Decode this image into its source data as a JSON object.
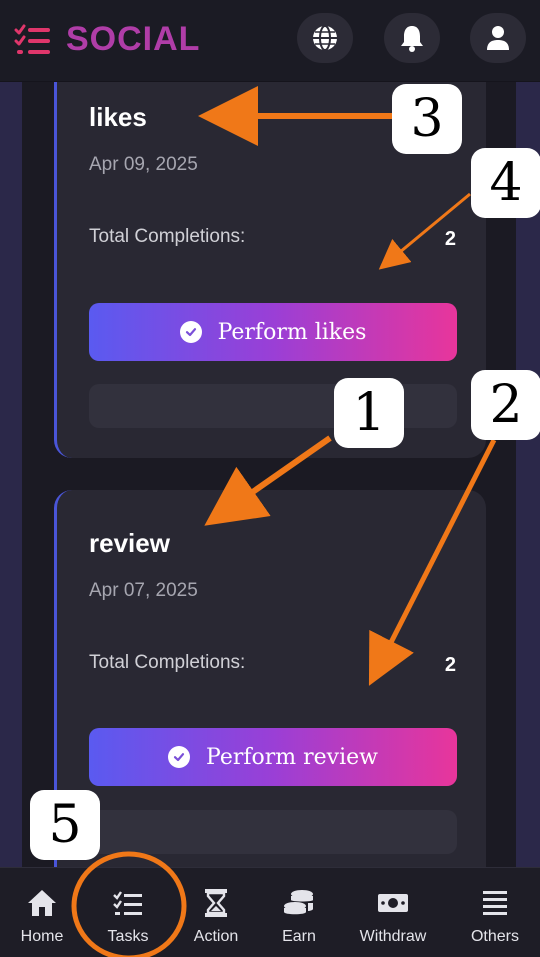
{
  "app": {
    "title": "SOCIAL",
    "brand_color": "#b03da8"
  },
  "header": {
    "icons": [
      "globe-icon",
      "bell-icon",
      "user-icon"
    ]
  },
  "tasks": [
    {
      "title": "likes",
      "date": "Apr 09, 2025",
      "completions_label": "Total Completions:",
      "completions": "2",
      "button_label": "Perform likes"
    },
    {
      "title": "review",
      "date": "Apr 07, 2025",
      "completions_label": "Total Completions:",
      "completions": "2",
      "button_label": "Perform review"
    }
  ],
  "annotations": {
    "n1": "1",
    "n2": "2",
    "n3": "3",
    "n4": "4",
    "n5": "5",
    "arrow_color": "#f07818"
  },
  "nav": {
    "items": [
      {
        "label": "Home",
        "icon": "home-icon"
      },
      {
        "label": "Tasks",
        "icon": "tasks-icon"
      },
      {
        "label": "Action",
        "icon": "hourglass-icon"
      },
      {
        "label": "Earn",
        "icon": "coins-icon"
      },
      {
        "label": "Withdraw",
        "icon": "money-icon"
      },
      {
        "label": "Others",
        "icon": "menu-icon"
      }
    ]
  }
}
